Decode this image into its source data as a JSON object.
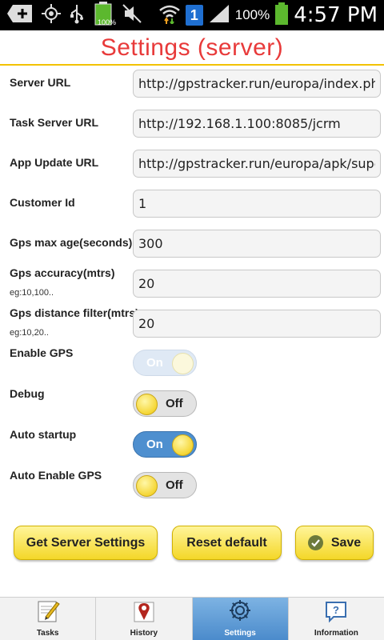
{
  "status_bar": {
    "battery_small_pct": "100%",
    "notification_count": "1",
    "battery_pct": "100%",
    "time": "4:57 PM"
  },
  "title": "Settings (server)",
  "fields": [
    {
      "label": "Server URL",
      "value": "http://gpstracker.run/europa/index.php"
    },
    {
      "label": "Task Server URL",
      "value": "http://192.168.1.100:8085/jcrm"
    },
    {
      "label": "App Update URL",
      "value": "http://gpstracker.run/europa/apk/superG"
    },
    {
      "label": "Customer Id",
      "value": "1"
    },
    {
      "label": "Gps max age(seconds)",
      "value": "300"
    },
    {
      "label": "Gps accuracy(mtrs)",
      "hint": "eg:10,100..",
      "value": "20"
    },
    {
      "label": "Gps distance filter(mtrs)",
      "hint": "eg:10,20..",
      "value": "20"
    }
  ],
  "toggles": [
    {
      "label": "Enable GPS",
      "state": "On"
    },
    {
      "label": "Debug",
      "state": "Off"
    },
    {
      "label": "Auto startup",
      "state": "On"
    },
    {
      "label": "Auto Enable GPS",
      "state": "Off"
    }
  ],
  "buttons": {
    "get_server_settings": "Get Server Settings",
    "reset_default": "Reset default",
    "save": "Save"
  },
  "tabs": [
    {
      "label": "Tasks",
      "icon": "notepad-pencil-icon"
    },
    {
      "label": "History",
      "icon": "map-pin-icon"
    },
    {
      "label": "Settings",
      "icon": "gear-icon",
      "active": true
    },
    {
      "label": "Information",
      "icon": "info-question-icon"
    }
  ],
  "colors": {
    "title": "#e83a3a",
    "accent_line": "#f2c200",
    "toggle_on": "#4e8fcf",
    "button_yellow": "#f4d728",
    "active_tab": "#4a8acb"
  }
}
